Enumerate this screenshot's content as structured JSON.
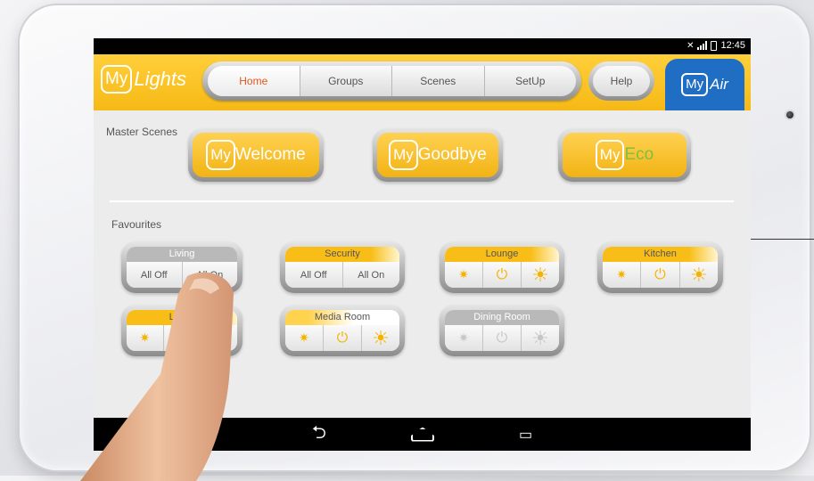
{
  "status_bar": {
    "time": "12:45"
  },
  "header": {
    "logo": {
      "my": "My",
      "name": "Lights"
    },
    "tabs": [
      {
        "label": "Home",
        "active": true
      },
      {
        "label": "Groups",
        "active": false
      },
      {
        "label": "Scenes",
        "active": false
      },
      {
        "label": "SetUp",
        "active": false
      }
    ],
    "help_label": "Help",
    "myair": {
      "my": "My",
      "name": "Air"
    }
  },
  "master_scenes": {
    "label": "Master Scenes",
    "buttons": [
      {
        "my": "My",
        "name": "Welcome"
      },
      {
        "my": "My",
        "name": "Goodbye"
      },
      {
        "my": "My",
        "name": "Eco"
      }
    ]
  },
  "favourites": {
    "label": "Favourites",
    "items": [
      {
        "title": "Living",
        "type": "switch",
        "off_label": "All Off",
        "on_label": "All On"
      },
      {
        "title": "Security",
        "type": "switch",
        "off_label": "All Off",
        "on_label": "All On"
      },
      {
        "title": "Lounge",
        "type": "dimmer"
      },
      {
        "title": "Kitchen",
        "type": "dimmer"
      },
      {
        "title": "Living",
        "type": "dimmer"
      },
      {
        "title": "Media Room",
        "type": "dimmer"
      },
      {
        "title": "Dining Room",
        "type": "dimmer",
        "disabled": true
      }
    ]
  },
  "colors": {
    "accent_yellow": "#f6b916",
    "myair_blue": "#1f6ec4",
    "active_tab": "#e3561b",
    "eco_green": "#7cc142"
  },
  "icons": {
    "dim": "sun-small-icon",
    "power": "power-icon",
    "bright": "sun-large-icon",
    "nav": [
      "back-icon",
      "home-icon",
      "recents-icon"
    ]
  }
}
